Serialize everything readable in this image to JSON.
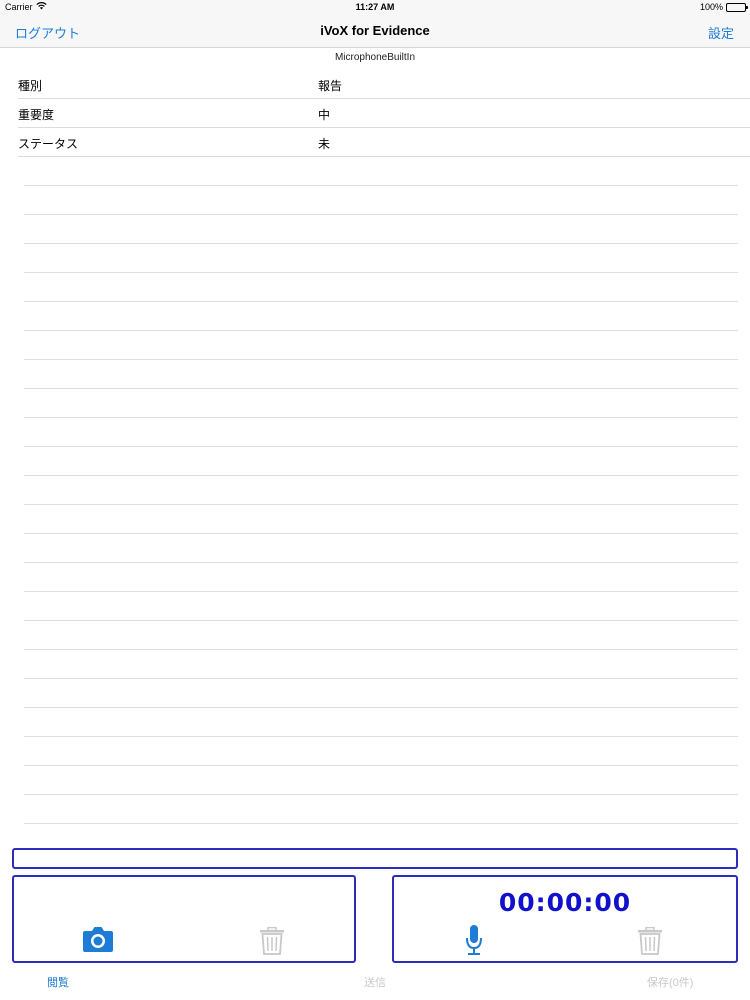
{
  "status_bar": {
    "carrier": "Carrier",
    "time": "11:27 AM",
    "battery": "100%",
    "battery_level": 1.0
  },
  "nav": {
    "left_button": "ログアウト",
    "title": "iVoX for Evidence",
    "right_button": "設定"
  },
  "device_label": "MicrophoneBuiltIn",
  "info_rows": [
    {
      "label": "種別",
      "value": "報告"
    },
    {
      "label": "重要度",
      "value": "中"
    },
    {
      "label": "ステータス",
      "value": "未"
    }
  ],
  "text_input": {
    "value": ""
  },
  "recorder": {
    "timer": "00:00:00"
  },
  "tabs": {
    "browse": "閲覧",
    "send": "送信",
    "save": "保存(0件)"
  },
  "colors": {
    "accent_blue": "#1c7cd6",
    "panel_border": "#2d2dbb",
    "timer_text": "#1111cc",
    "disabled_gray": "#c8c8c8"
  },
  "icons": {
    "camera": "camera-icon",
    "microphone": "microphone-icon",
    "trash": "trash-icon",
    "wifi": "wifi-icon",
    "battery": "battery-icon"
  }
}
